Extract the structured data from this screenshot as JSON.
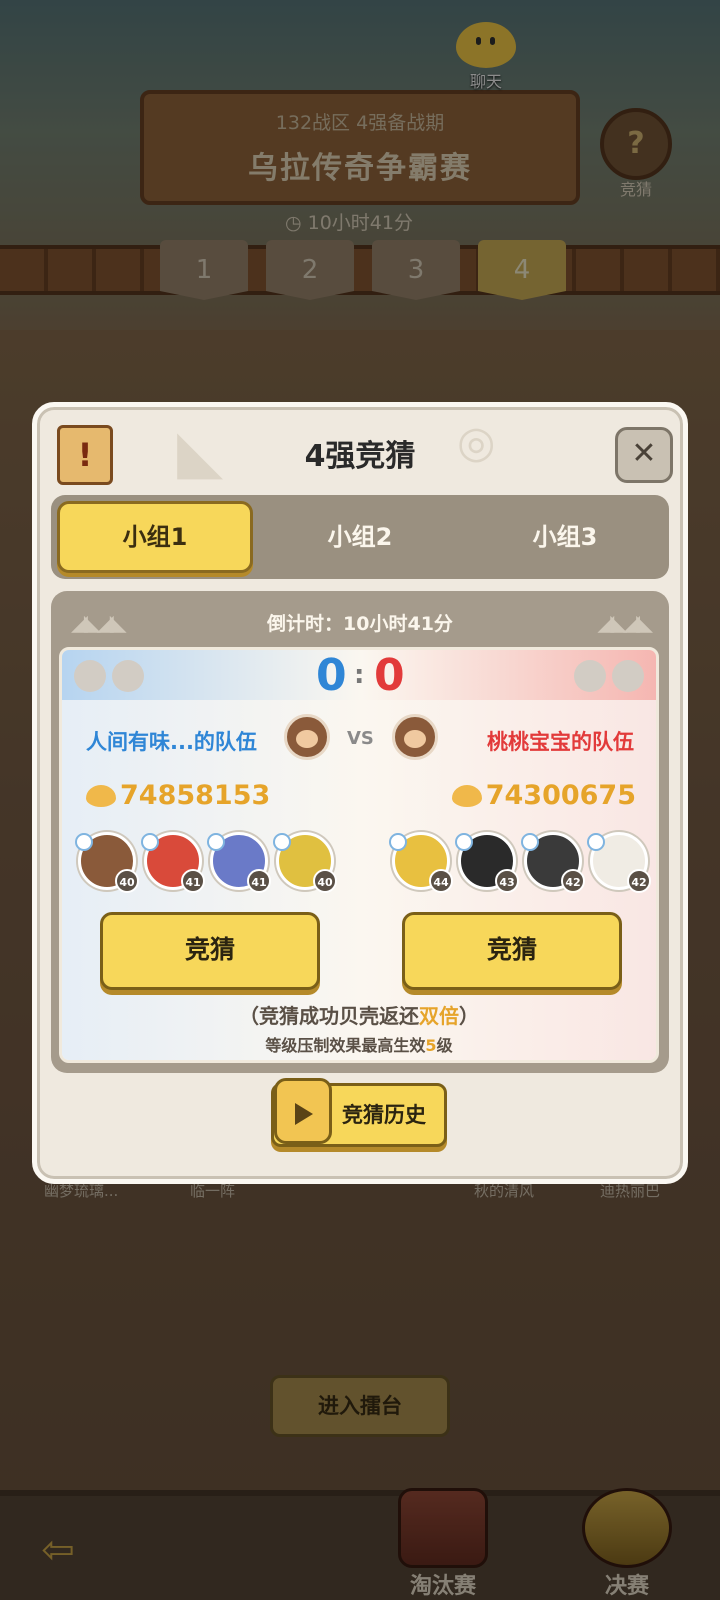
{
  "top": {
    "chat_label": "聊天",
    "guess_label": "竞猜",
    "subtitle": "132战区 4强备战期",
    "title": "乌拉传奇争霸赛",
    "timer": "10小时41分",
    "rounds": [
      "1",
      "2",
      "3",
      "4"
    ],
    "active_round": 4
  },
  "modal": {
    "title": "4强竞猜",
    "close_symbol": "✕",
    "groups": [
      "小组1",
      "小组2",
      "小组3"
    ],
    "active_group": 0,
    "countdown": "倒计时：10小时41分",
    "score_left": "0",
    "score_sep": ":",
    "score_right": "0",
    "vs": "VS",
    "left_team": {
      "name": "人间有味...的队伍",
      "power": "74858153",
      "hero_levels": [
        "40",
        "41",
        "41",
        "40"
      ]
    },
    "right_team": {
      "name": "桃桃宝宝的队伍",
      "power": "74300675",
      "hero_levels": [
        "44",
        "43",
        "42",
        "42"
      ]
    },
    "guess_button": "竞猜",
    "note1_prefix": "（竞猜成功贝壳返还",
    "note1_highlight": "双倍",
    "note1_suffix": "）",
    "note2_prefix": "等级压制效果最高生效",
    "note2_highlight": "5",
    "note2_suffix": "级",
    "history_button": "竞猜历史"
  },
  "background": {
    "names": [
      "幽梦琉璃...",
      "临一阵",
      "秋的清风",
      "迪热丽巴"
    ],
    "enter_button": "进入擂台",
    "tabs": [
      "淘汰赛",
      "决赛"
    ]
  },
  "colors": {
    "blue_team": "#2f86d6",
    "red_team": "#e23a3a",
    "gold": "#e6a42a",
    "button": "#f7d75a"
  }
}
